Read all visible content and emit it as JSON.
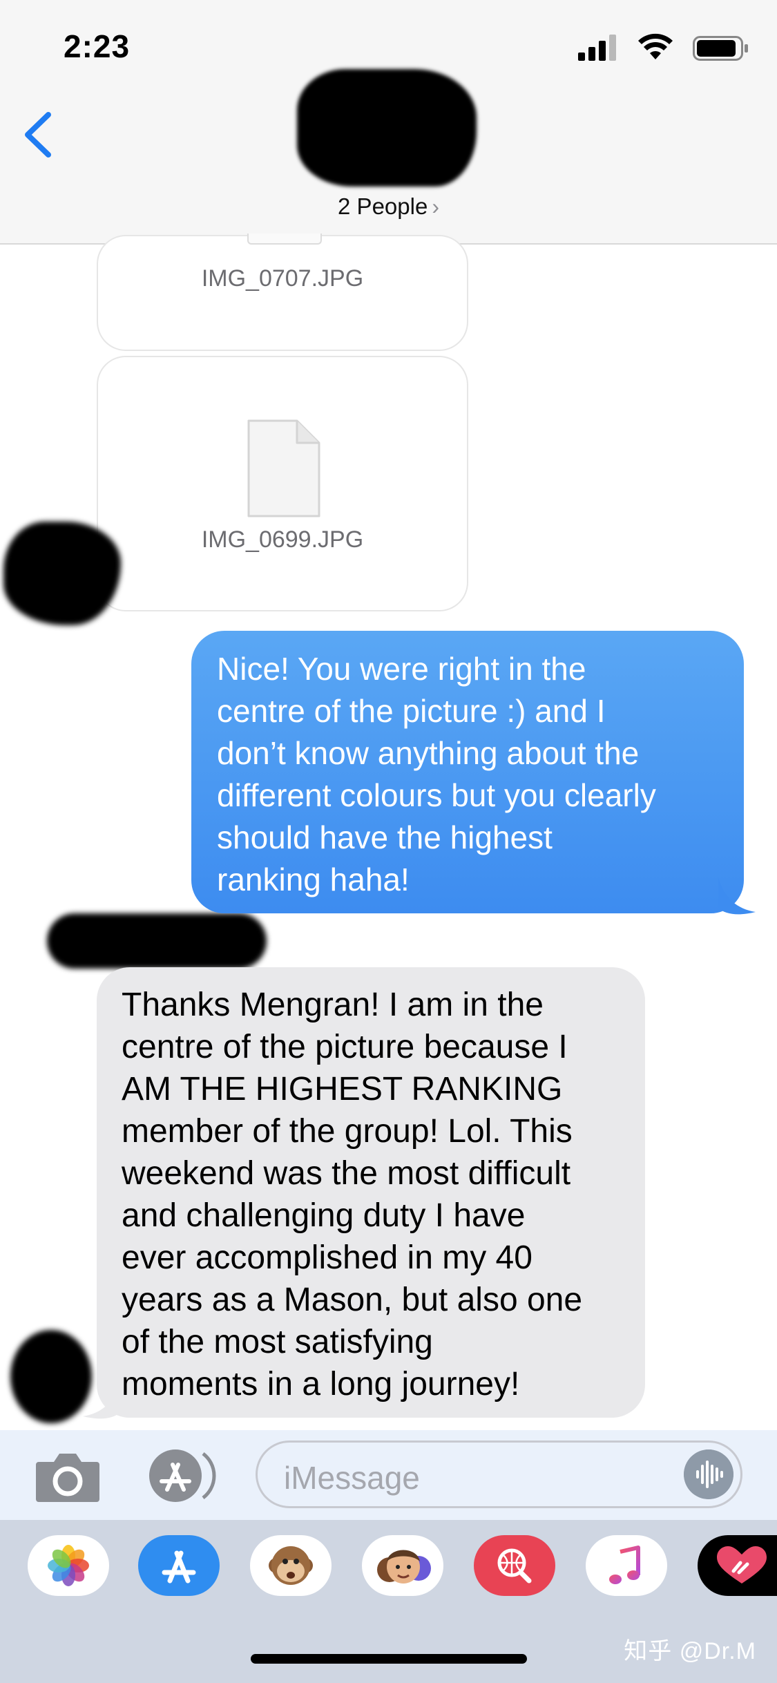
{
  "status_bar": {
    "time": "2:23",
    "icons": [
      "signal-icon",
      "wifi-icon",
      "battery-icon"
    ]
  },
  "header": {
    "back_icon": "chevron-left-icon",
    "people_label": "2 People",
    "people_chevron": "›"
  },
  "attachments": [
    {
      "file_name": "IMG_0707.JPG"
    },
    {
      "file_name": "IMG_0699.JPG"
    }
  ],
  "messages": [
    {
      "direction": "sent",
      "text": "Nice! You were right in the\ncentre of the picture :) and I\ndon’t know anything about the\ndifferent colours but you clearly\nshould have the highest\nranking haha!"
    },
    {
      "direction": "received",
      "text": "Thanks Mengran! I am in the\ncentre of the picture because I\nAM THE HIGHEST RANKING\nmember of the group! Lol. This\nweekend was the most difficult\nand challenging duty I have\never accomplished in my 40\nyears as a Mason, but also one\nof the most  satisfying\nmoments in a long journey!"
    }
  ],
  "input_bar": {
    "placeholder": "iMessage"
  },
  "app_drawer": {
    "apps": [
      "photos-app-icon",
      "app-store-icon",
      "animoji-icon",
      "memoji-icon",
      "web-images-search-icon",
      "music-icon",
      "digital-touch-icon"
    ]
  },
  "watermark": "知乎 @Dr.M",
  "colors": {
    "sent_bubble": "#3d8cf0",
    "received_bubble": "#e9e9eb",
    "accent": "#1f7cf2"
  }
}
